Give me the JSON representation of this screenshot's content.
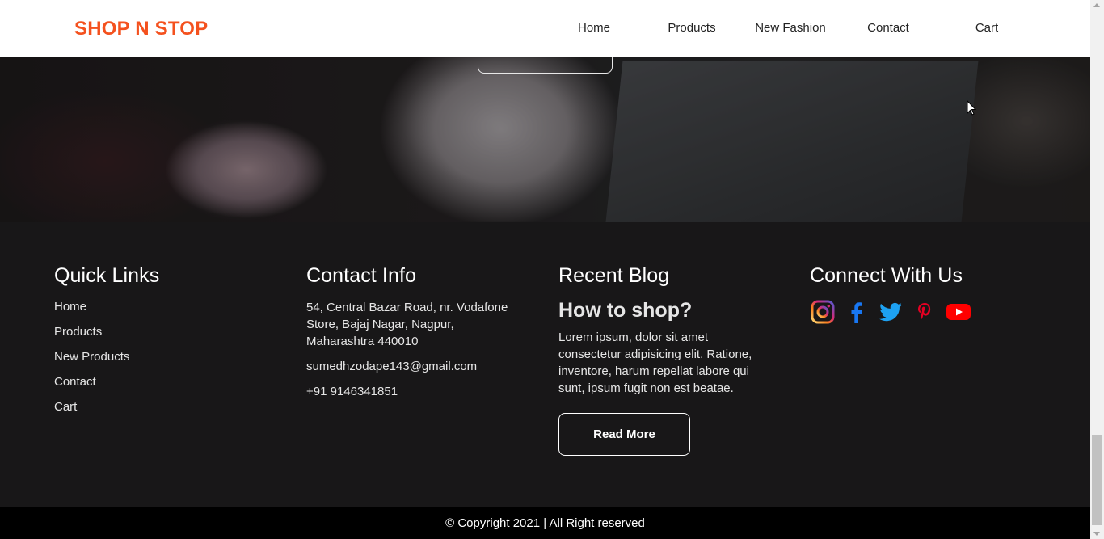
{
  "header": {
    "logo": "SHOP N STOP",
    "nav": [
      "Home",
      "Products",
      "New Fashion",
      "Contact",
      "Cart"
    ]
  },
  "footer": {
    "quick_links": {
      "title": "Quick Links",
      "items": [
        "Home",
        "Products",
        "New Products",
        "Contact",
        "Cart"
      ]
    },
    "contact_info": {
      "title": "Contact Info",
      "address": "54, Central Bazar Road, nr. Vodafone Store, Bajaj Nagar, Nagpur, Maharashtra 440010",
      "email": "sumedhzodape143@gmail.com",
      "phone": "+91 9146341851"
    },
    "recent_blog": {
      "title": "Recent Blog",
      "post_title": "How to shop?",
      "excerpt": "Lorem ipsum, dolor sit amet consectetur adipisicing elit. Ratione, inventore, harum repellat labore qui sunt, ipsum fugit non est beatae.",
      "button": "Read More"
    },
    "connect": {
      "title": "Connect With Us",
      "icons": [
        "instagram-icon",
        "facebook-icon",
        "twitter-icon",
        "pinterest-icon",
        "youtube-icon"
      ]
    }
  },
  "copyright": "© Copyright 2021 | All Right reserved",
  "colors": {
    "brand": "#f4511e",
    "footer_bg": "#181718",
    "bottom_bar": "#000000"
  }
}
